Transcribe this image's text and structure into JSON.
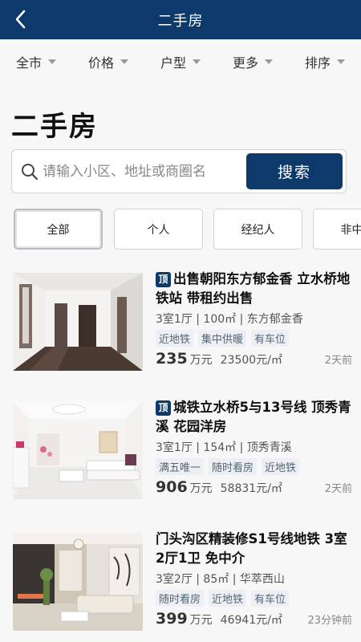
{
  "header": {
    "title": "二手房",
    "back_icon": "chevron-left-icon"
  },
  "filters": [
    {
      "label": "全市"
    },
    {
      "label": "价格"
    },
    {
      "label": "户型"
    },
    {
      "label": "更多"
    },
    {
      "label": "排序"
    }
  ],
  "page_title": "二手房",
  "search": {
    "placeholder": "请输入小区、地址或商圈名",
    "button_label": "搜索"
  },
  "tabs": [
    {
      "label": "全部",
      "active": true
    },
    {
      "label": "个人"
    },
    {
      "label": "经纪人"
    },
    {
      "label": "非中介"
    }
  ],
  "listings": [
    {
      "badge": "顶",
      "title": "出售朝阳东方郁金香 立水桥地铁站 带租约出售",
      "specs": "3室1厅 | 100㎡ | 东方郁金香",
      "tags": [
        "近地铁",
        "集中供暖",
        "有车位"
      ],
      "price": "235",
      "price_unit": "万元",
      "unit_price": "23500元/㎡",
      "time": "2天前"
    },
    {
      "badge": "顶",
      "title": "城铁立水桥5与13号线 顶秀青溪 花园洋房",
      "specs": "3室1厅 | 154㎡ | 顶秀青溪",
      "tags": [
        "满五唯一",
        "随时看房",
        "近地铁"
      ],
      "price": "906",
      "price_unit": "万元",
      "unit_price": "58831元/㎡",
      "time": "2天前"
    },
    {
      "badge": "",
      "title": "门头沟区精装修S1号线地铁 3室2厅1卫 免中介",
      "specs": "3室2厅 | 85㎡ | 华萃西山",
      "tags": [
        "随时看房",
        "近地铁",
        "有车位"
      ],
      "price": "399",
      "price_unit": "万元",
      "unit_price": "46941元/㎡",
      "time": "23分钟前"
    }
  ],
  "colors": {
    "brand": "#0d3a6b",
    "tag_bg": "#eceff3",
    "background": "#f7f7f7"
  }
}
